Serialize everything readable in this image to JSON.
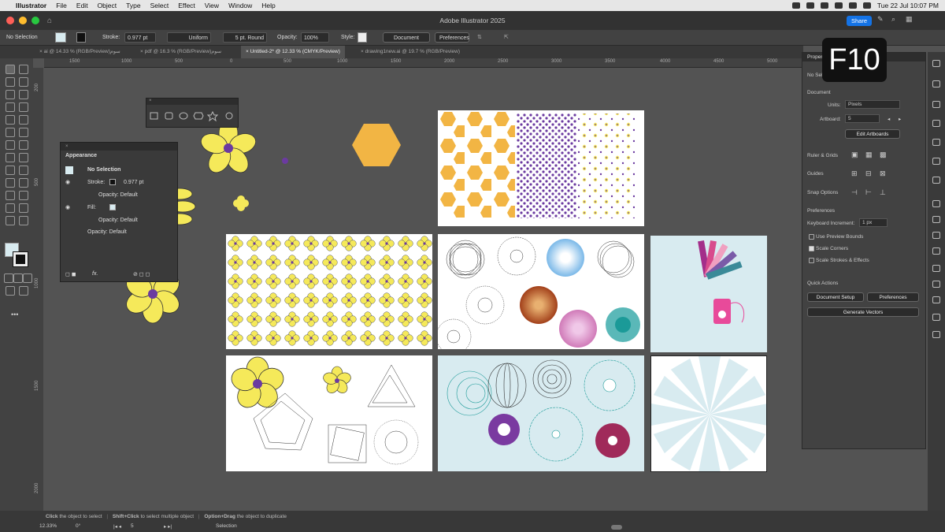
{
  "menubar": {
    "app": "Illustrator",
    "items": [
      "File",
      "Edit",
      "Object",
      "Type",
      "Select",
      "Effect",
      "View",
      "Window",
      "Help"
    ],
    "datetime": "Tue 22 Jul  10:07 PM"
  },
  "titlebar": {
    "title": "Adobe Illustrator 2025",
    "share": "Share"
  },
  "control": {
    "selection": "No Selection",
    "stroke_label": "Stroke:",
    "stroke_value": "0.977 pt",
    "profile": "Uniform",
    "brush": "5 pt. Round",
    "opacity_label": "Opacity:",
    "opacity_value": "100%",
    "style_label": "Style:",
    "doc_setup": "Document Setup",
    "preferences": "Preferences"
  },
  "tabs": [
    "ai @ 14.33 % (RGB/Preview)سوم",
    "pdf @ 16.3 % (RGB/Preview)سوم",
    "Untitled-2* @ 12.33 % (CMYK/Preview)",
    "drawing1new.ai @ 19.7 % (RGB/Preview)"
  ],
  "ruler": [
    "1500",
    "1000",
    "500",
    "0",
    "500",
    "1000",
    "1500",
    "2000",
    "2500",
    "3000",
    "3500",
    "4000",
    "4500",
    "5000"
  ],
  "ruler_v": [
    "200",
    "500",
    "1000",
    "1500",
    "2000"
  ],
  "appearance": {
    "title": "Appearance",
    "no_selection": "No Selection",
    "stroke": "Stroke:",
    "stroke_value": "0.977 pt",
    "opacity1": "Opacity: Default",
    "fill": "Fill:",
    "opacity2": "Opacity: Default",
    "opacity3": "Opacity: Default",
    "fx": "fx."
  },
  "properties": {
    "tab": "Proper",
    "no_sel": "No Sel",
    "document": "Document",
    "units_label": "Units:",
    "units_value": "Pixels",
    "artboard_label": "Artboard:",
    "artboard_value": "5",
    "edit_artboards": "Edit Artboards",
    "ruler_grids": "Ruler & Grids",
    "guides": "Guides",
    "snap": "Snap Options",
    "preferences": "Preferences",
    "keyboard_inc": "Keyboard Increment:",
    "keyboard_value": "1 px",
    "use_preview": "Use Preview Bounds",
    "scale_corners": "Scale Corners",
    "scale_strokes": "Scale Strokes & Effects",
    "quick_actions": "Quick Actions",
    "doc_setup": "Document Setup",
    "prefs_btn": "Preferences",
    "generate_vectors": "Generate Vectors"
  },
  "overlay": "F10",
  "status": {
    "hint_click": "Click",
    "hint1": "the object to select",
    "hint_shift": "Shift+Click",
    "hint2": "to select multiple object",
    "hint_opt": "Option+Drag",
    "hint3": "the object to duplicate",
    "zoom": "12.33%",
    "angle": "0°",
    "artboard": "5",
    "mode": "Selection"
  },
  "colors": {
    "yellow": "#f5e95a",
    "purple": "#6b3aa0",
    "orange": "#f2b544",
    "teal": "#1b9a98",
    "lightblue": "#d8ebf0"
  }
}
